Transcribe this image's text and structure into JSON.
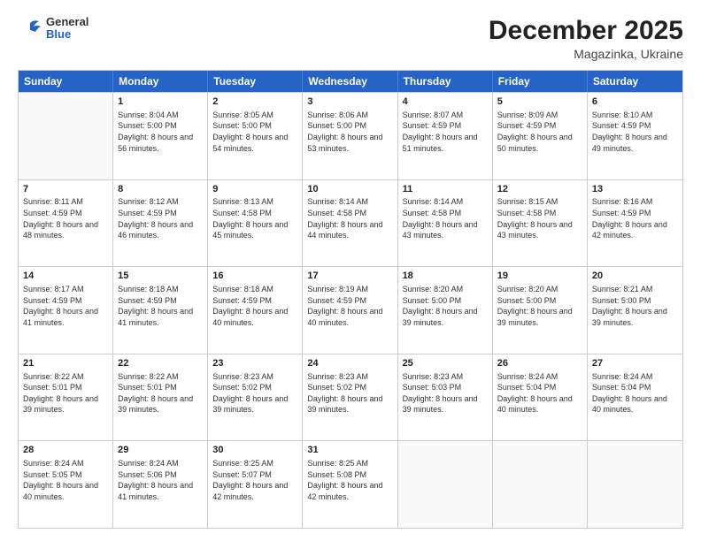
{
  "logo": {
    "general": "General",
    "blue": "Blue"
  },
  "title": "December 2025",
  "location": "Magazinka, Ukraine",
  "days_of_week": [
    "Sunday",
    "Monday",
    "Tuesday",
    "Wednesday",
    "Thursday",
    "Friday",
    "Saturday"
  ],
  "weeks": [
    [
      {
        "day": "",
        "sunrise": "",
        "sunset": "",
        "daylight": "",
        "empty": true
      },
      {
        "day": "1",
        "sunrise": "Sunrise: 8:04 AM",
        "sunset": "Sunset: 5:00 PM",
        "daylight": "Daylight: 8 hours and 56 minutes.",
        "empty": false
      },
      {
        "day": "2",
        "sunrise": "Sunrise: 8:05 AM",
        "sunset": "Sunset: 5:00 PM",
        "daylight": "Daylight: 8 hours and 54 minutes.",
        "empty": false
      },
      {
        "day": "3",
        "sunrise": "Sunrise: 8:06 AM",
        "sunset": "Sunset: 5:00 PM",
        "daylight": "Daylight: 8 hours and 53 minutes.",
        "empty": false
      },
      {
        "day": "4",
        "sunrise": "Sunrise: 8:07 AM",
        "sunset": "Sunset: 4:59 PM",
        "daylight": "Daylight: 8 hours and 51 minutes.",
        "empty": false
      },
      {
        "day": "5",
        "sunrise": "Sunrise: 8:09 AM",
        "sunset": "Sunset: 4:59 PM",
        "daylight": "Daylight: 8 hours and 50 minutes.",
        "empty": false
      },
      {
        "day": "6",
        "sunrise": "Sunrise: 8:10 AM",
        "sunset": "Sunset: 4:59 PM",
        "daylight": "Daylight: 8 hours and 49 minutes.",
        "empty": false
      }
    ],
    [
      {
        "day": "7",
        "sunrise": "Sunrise: 8:11 AM",
        "sunset": "Sunset: 4:59 PM",
        "daylight": "Daylight: 8 hours and 48 minutes.",
        "empty": false
      },
      {
        "day": "8",
        "sunrise": "Sunrise: 8:12 AM",
        "sunset": "Sunset: 4:59 PM",
        "daylight": "Daylight: 8 hours and 46 minutes.",
        "empty": false
      },
      {
        "day": "9",
        "sunrise": "Sunrise: 8:13 AM",
        "sunset": "Sunset: 4:58 PM",
        "daylight": "Daylight: 8 hours and 45 minutes.",
        "empty": false
      },
      {
        "day": "10",
        "sunrise": "Sunrise: 8:14 AM",
        "sunset": "Sunset: 4:58 PM",
        "daylight": "Daylight: 8 hours and 44 minutes.",
        "empty": false
      },
      {
        "day": "11",
        "sunrise": "Sunrise: 8:14 AM",
        "sunset": "Sunset: 4:58 PM",
        "daylight": "Daylight: 8 hours and 43 minutes.",
        "empty": false
      },
      {
        "day": "12",
        "sunrise": "Sunrise: 8:15 AM",
        "sunset": "Sunset: 4:58 PM",
        "daylight": "Daylight: 8 hours and 43 minutes.",
        "empty": false
      },
      {
        "day": "13",
        "sunrise": "Sunrise: 8:16 AM",
        "sunset": "Sunset: 4:59 PM",
        "daylight": "Daylight: 8 hours and 42 minutes.",
        "empty": false
      }
    ],
    [
      {
        "day": "14",
        "sunrise": "Sunrise: 8:17 AM",
        "sunset": "Sunset: 4:59 PM",
        "daylight": "Daylight: 8 hours and 41 minutes.",
        "empty": false
      },
      {
        "day": "15",
        "sunrise": "Sunrise: 8:18 AM",
        "sunset": "Sunset: 4:59 PM",
        "daylight": "Daylight: 8 hours and 41 minutes.",
        "empty": false
      },
      {
        "day": "16",
        "sunrise": "Sunrise: 8:18 AM",
        "sunset": "Sunset: 4:59 PM",
        "daylight": "Daylight: 8 hours and 40 minutes.",
        "empty": false
      },
      {
        "day": "17",
        "sunrise": "Sunrise: 8:19 AM",
        "sunset": "Sunset: 4:59 PM",
        "daylight": "Daylight: 8 hours and 40 minutes.",
        "empty": false
      },
      {
        "day": "18",
        "sunrise": "Sunrise: 8:20 AM",
        "sunset": "Sunset: 5:00 PM",
        "daylight": "Daylight: 8 hours and 39 minutes.",
        "empty": false
      },
      {
        "day": "19",
        "sunrise": "Sunrise: 8:20 AM",
        "sunset": "Sunset: 5:00 PM",
        "daylight": "Daylight: 8 hours and 39 minutes.",
        "empty": false
      },
      {
        "day": "20",
        "sunrise": "Sunrise: 8:21 AM",
        "sunset": "Sunset: 5:00 PM",
        "daylight": "Daylight: 8 hours and 39 minutes.",
        "empty": false
      }
    ],
    [
      {
        "day": "21",
        "sunrise": "Sunrise: 8:22 AM",
        "sunset": "Sunset: 5:01 PM",
        "daylight": "Daylight: 8 hours and 39 minutes.",
        "empty": false
      },
      {
        "day": "22",
        "sunrise": "Sunrise: 8:22 AM",
        "sunset": "Sunset: 5:01 PM",
        "daylight": "Daylight: 8 hours and 39 minutes.",
        "empty": false
      },
      {
        "day": "23",
        "sunrise": "Sunrise: 8:23 AM",
        "sunset": "Sunset: 5:02 PM",
        "daylight": "Daylight: 8 hours and 39 minutes.",
        "empty": false
      },
      {
        "day": "24",
        "sunrise": "Sunrise: 8:23 AM",
        "sunset": "Sunset: 5:02 PM",
        "daylight": "Daylight: 8 hours and 39 minutes.",
        "empty": false
      },
      {
        "day": "25",
        "sunrise": "Sunrise: 8:23 AM",
        "sunset": "Sunset: 5:03 PM",
        "daylight": "Daylight: 8 hours and 39 minutes.",
        "empty": false
      },
      {
        "day": "26",
        "sunrise": "Sunrise: 8:24 AM",
        "sunset": "Sunset: 5:04 PM",
        "daylight": "Daylight: 8 hours and 40 minutes.",
        "empty": false
      },
      {
        "day": "27",
        "sunrise": "Sunrise: 8:24 AM",
        "sunset": "Sunset: 5:04 PM",
        "daylight": "Daylight: 8 hours and 40 minutes.",
        "empty": false
      }
    ],
    [
      {
        "day": "28",
        "sunrise": "Sunrise: 8:24 AM",
        "sunset": "Sunset: 5:05 PM",
        "daylight": "Daylight: 8 hours and 40 minutes.",
        "empty": false
      },
      {
        "day": "29",
        "sunrise": "Sunrise: 8:24 AM",
        "sunset": "Sunset: 5:06 PM",
        "daylight": "Daylight: 8 hours and 41 minutes.",
        "empty": false
      },
      {
        "day": "30",
        "sunrise": "Sunrise: 8:25 AM",
        "sunset": "Sunset: 5:07 PM",
        "daylight": "Daylight: 8 hours and 42 minutes.",
        "empty": false
      },
      {
        "day": "31",
        "sunrise": "Sunrise: 8:25 AM",
        "sunset": "Sunset: 5:08 PM",
        "daylight": "Daylight: 8 hours and 42 minutes.",
        "empty": false
      },
      {
        "day": "",
        "sunrise": "",
        "sunset": "",
        "daylight": "",
        "empty": true
      },
      {
        "day": "",
        "sunrise": "",
        "sunset": "",
        "daylight": "",
        "empty": true
      },
      {
        "day": "",
        "sunrise": "",
        "sunset": "",
        "daylight": "",
        "empty": true
      }
    ]
  ]
}
